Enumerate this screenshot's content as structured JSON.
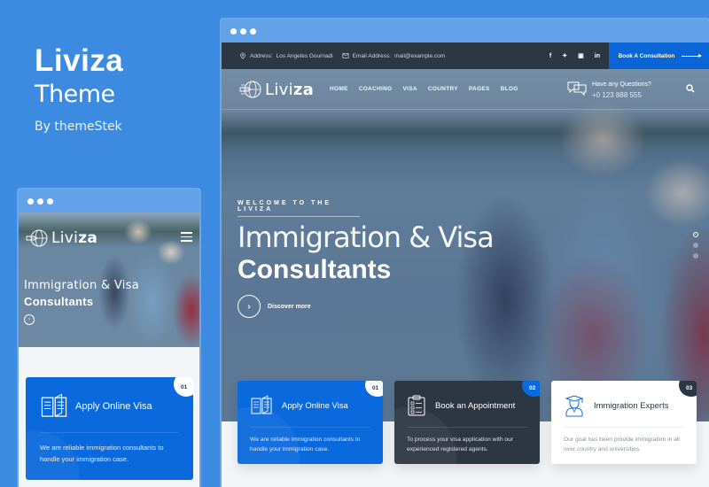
{
  "branding": {
    "title": "Liviza",
    "subtitle": "Theme",
    "author": "By themeStek"
  },
  "desktop": {
    "topbar": {
      "address_label": "Address:",
      "address_value": "Los Angeles Gournadi",
      "email_label": "Email Address:",
      "email_value": "mail@example.com",
      "socials": [
        {
          "icon": "facebook-icon",
          "glyph": "f"
        },
        {
          "icon": "twitter-icon",
          "glyph": "✦"
        },
        {
          "icon": "flickr-icon",
          "glyph": "▣"
        },
        {
          "icon": "linkedin-icon",
          "glyph": "in"
        }
      ],
      "cta_label": "Book A Consultation"
    },
    "nav": {
      "logo_light": "Livi",
      "logo_bold": "za",
      "menu": [
        "HOME",
        "COACHING",
        "VISA",
        "COUNTRY",
        "PAGES",
        "BLOG"
      ],
      "contact_label": "Have any Questions?",
      "contact_phone": "+0 123 888 555"
    },
    "hero": {
      "eyebrow": "WELCOME TO THE LIVIZA",
      "headline_light": "Immigration & Visa",
      "headline_bold": "Consultants",
      "cta_label": "Discover more",
      "slides_total": 3,
      "slide_active": 1
    },
    "cards": [
      {
        "number": "01",
        "title": "Apply Online Visa",
        "icon": "open-book-icon",
        "theme": "blue",
        "description": "We are reliable immigration consultants to handle your immigration case."
      },
      {
        "number": "02",
        "title": "Book an Appointment",
        "icon": "clipboard-checklist-icon",
        "theme": "dark",
        "description": "To process your visa application with our experienced registered agents."
      },
      {
        "number": "03",
        "title": "Immigration Experts",
        "icon": "graduate-icon",
        "theme": "light",
        "description": "Our goal has been provide immigration in all over country and universities."
      }
    ]
  },
  "mobile": {
    "logo_light": "Livi",
    "logo_bold": "za",
    "headline_light": "Immigration & Visa",
    "headline_bold": "Consultants",
    "card": {
      "number": "01",
      "title": "Apply Online Visa",
      "description": "We are reliable immigration consultants to handle your immigration case."
    }
  },
  "colors": {
    "background": "#3d8be0",
    "brand_blue": "#0a69dd",
    "dark": "#2d3643"
  }
}
